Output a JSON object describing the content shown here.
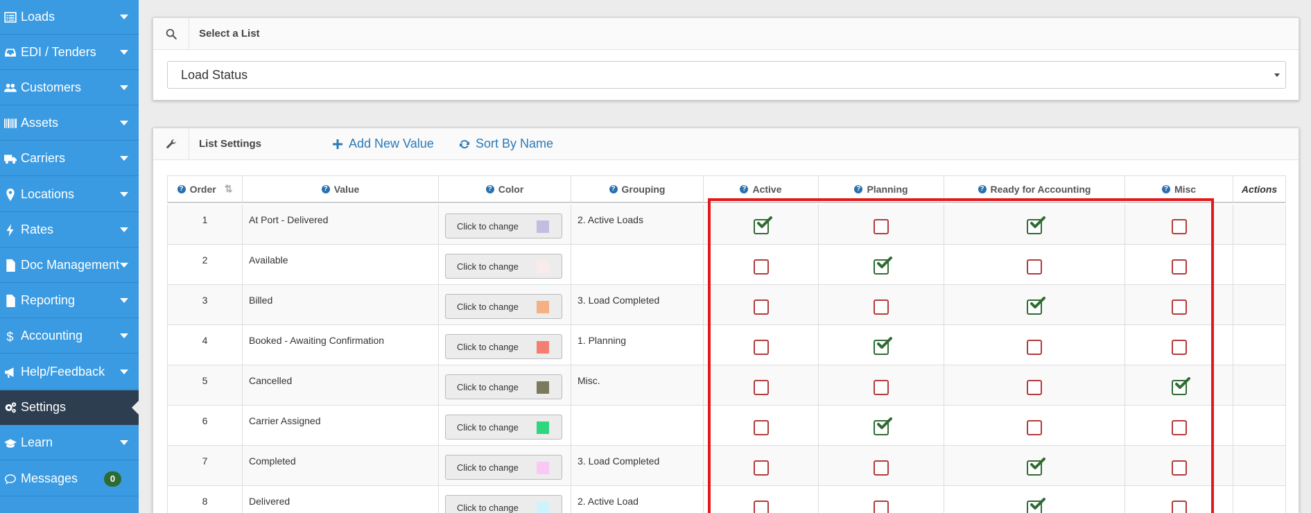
{
  "sidebar": {
    "items": [
      {
        "label": "Loads",
        "icon": "list-icon"
      },
      {
        "label": "EDI / Tenders",
        "icon": "inbox-icon"
      },
      {
        "label": "Customers",
        "icon": "users-icon"
      },
      {
        "label": "Assets",
        "icon": "barcode-icon"
      },
      {
        "label": "Carriers",
        "icon": "truck-icon"
      },
      {
        "label": "Locations",
        "icon": "map-marker-icon"
      },
      {
        "label": "Rates",
        "icon": "bolt-icon"
      },
      {
        "label": "Doc Management",
        "icon": "file-icon"
      },
      {
        "label": "Reporting",
        "icon": "file-text-icon"
      },
      {
        "label": "Accounting",
        "icon": "dollar-icon"
      },
      {
        "label": "Help/Feedback",
        "icon": "bullhorn-icon"
      },
      {
        "label": "Settings",
        "icon": "gears-icon",
        "active": true
      },
      {
        "label": "Learn",
        "icon": "graduation-cap-icon"
      },
      {
        "label": "Messages",
        "icon": "comment-icon",
        "badge": "0"
      }
    ]
  },
  "select_panel": {
    "title": "Select a List",
    "selected_value": "Load Status"
  },
  "settings_panel": {
    "title": "List Settings",
    "add_label": "Add New Value",
    "sort_label": "Sort By Name"
  },
  "table": {
    "headers": {
      "order": "Order",
      "value": "Value",
      "color": "Color",
      "grouping": "Grouping",
      "active": "Active",
      "planning": "Planning",
      "ready": "Ready for Accounting",
      "misc": "Misc",
      "actions": "Actions"
    },
    "color_button_label": "Click to change",
    "rows": [
      {
        "order": "1",
        "value": "At Port - Delivered",
        "color": "#c3bde0",
        "grouping": "2. Active Loads",
        "active": true,
        "planning": false,
        "ready": true,
        "misc": false
      },
      {
        "order": "2",
        "value": "Available",
        "color": "#fbeaec",
        "grouping": "",
        "active": false,
        "planning": true,
        "ready": false,
        "misc": false
      },
      {
        "order": "3",
        "value": "Billed",
        "color": "#f4b183",
        "grouping": "3. Load Completed",
        "active": false,
        "planning": false,
        "ready": true,
        "misc": false
      },
      {
        "order": "4",
        "value": "Booked - Awaiting Confirmation",
        "color": "#f47f70",
        "grouping": "1. Planning",
        "active": false,
        "planning": true,
        "ready": false,
        "misc": false
      },
      {
        "order": "5",
        "value": "Cancelled",
        "color": "#7b7a5e",
        "grouping": "Misc.",
        "active": false,
        "planning": false,
        "ready": false,
        "misc": true
      },
      {
        "order": "6",
        "value": "Carrier Assigned",
        "color": "#2ed67e",
        "grouping": "",
        "active": false,
        "planning": true,
        "ready": false,
        "misc": false
      },
      {
        "order": "7",
        "value": "Completed",
        "color": "#fbc7f3",
        "grouping": "3. Load Completed",
        "active": false,
        "planning": false,
        "ready": true,
        "misc": false
      },
      {
        "order": "8",
        "value": "Delivered",
        "color": "#cdf4fb",
        "grouping": "2. Active Load",
        "active": false,
        "planning": false,
        "ready": true,
        "misc": false
      }
    ]
  },
  "colors": {
    "sidebar": "#3a9be2",
    "sidebar_active": "#2c3e50",
    "link": "#2a7ab8",
    "check_on": "#2e6b33",
    "check_off": "#b23a3a",
    "highlight": "#e4181b"
  }
}
